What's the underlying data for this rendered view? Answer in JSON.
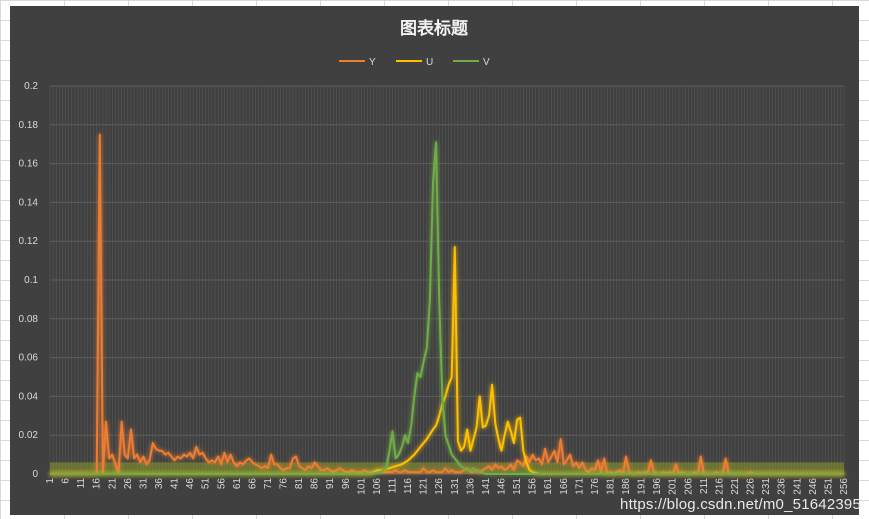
{
  "chart_data": {
    "type": "line",
    "title": "图表标题",
    "xlabel": "",
    "ylabel": "",
    "ylim": [
      0,
      0.2
    ],
    "yticks": [
      "0",
      "0.02",
      "0.04",
      "0.06",
      "0.08",
      "0.1",
      "0.12",
      "0.14",
      "0.16",
      "0.18",
      "0.2"
    ],
    "x_range": [
      1,
      256
    ],
    "x_tick_labels": [
      "1",
      "6",
      "11",
      "16",
      "21",
      "26",
      "31",
      "36",
      "41",
      "46",
      "51",
      "56",
      "61",
      "66",
      "71",
      "76",
      "81",
      "86",
      "91",
      "96",
      "101",
      "106",
      "111",
      "116",
      "121",
      "126",
      "131",
      "136",
      "141",
      "146",
      "151",
      "156",
      "161",
      "166",
      "171",
      "176",
      "181",
      "186",
      "191",
      "196",
      "201",
      "206",
      "211",
      "216",
      "221",
      "226",
      "231",
      "236",
      "241",
      "246",
      "251",
      "256"
    ],
    "legend_position": "top",
    "grid": true,
    "series": [
      {
        "name": "Y",
        "color": "#ed7d31",
        "points": [
          [
            1,
            0
          ],
          [
            16,
            0
          ],
          [
            17,
            0.175
          ],
          [
            18,
            0
          ],
          [
            19,
            0.027
          ],
          [
            20,
            0.008
          ],
          [
            21,
            0.01
          ],
          [
            22,
            0.005
          ],
          [
            23,
            0
          ],
          [
            24,
            0.027
          ],
          [
            25,
            0.01
          ],
          [
            26,
            0.008
          ],
          [
            27,
            0.023
          ],
          [
            28,
            0.008
          ],
          [
            29,
            0.01
          ],
          [
            30,
            0.006
          ],
          [
            31,
            0.009
          ],
          [
            32,
            0.005
          ],
          [
            33,
            0.007
          ],
          [
            34,
            0.016
          ],
          [
            35,
            0.013
          ],
          [
            36,
            0.012
          ],
          [
            37,
            0.012
          ],
          [
            38,
            0.01
          ],
          [
            39,
            0.011
          ],
          [
            40,
            0.009
          ],
          [
            41,
            0.007
          ],
          [
            42,
            0.009
          ],
          [
            43,
            0.008
          ],
          [
            44,
            0.01
          ],
          [
            45,
            0.009
          ],
          [
            46,
            0.011
          ],
          [
            47,
            0.008
          ],
          [
            48,
            0.014
          ],
          [
            49,
            0.01
          ],
          [
            50,
            0.011
          ],
          [
            51,
            0.008
          ],
          [
            52,
            0.006
          ],
          [
            53,
            0.007
          ],
          [
            54,
            0.006
          ],
          [
            55,
            0.009
          ],
          [
            56,
            0.005
          ],
          [
            57,
            0.011
          ],
          [
            58,
            0.006
          ],
          [
            59,
            0.01
          ],
          [
            60,
            0.006
          ],
          [
            61,
            0.004
          ],
          [
            62,
            0.006
          ],
          [
            63,
            0.005
          ],
          [
            64,
            0.007
          ],
          [
            65,
            0.008
          ],
          [
            66,
            0.006
          ],
          [
            67,
            0.005
          ],
          [
            68,
            0.004
          ],
          [
            69,
            0.003
          ],
          [
            70,
            0.004
          ],
          [
            71,
            0.003
          ],
          [
            72,
            0.01
          ],
          [
            73,
            0.005
          ],
          [
            74,
            0.005
          ],
          [
            75,
            0.003
          ],
          [
            76,
            0.002
          ],
          [
            77,
            0.003
          ],
          [
            78,
            0.003
          ],
          [
            79,
            0.008
          ],
          [
            80,
            0.009
          ],
          [
            81,
            0.004
          ],
          [
            82,
            0.003
          ],
          [
            83,
            0.002
          ],
          [
            84,
            0.004
          ],
          [
            85,
            0.003
          ],
          [
            86,
            0.006
          ],
          [
            87,
            0.004
          ],
          [
            88,
            0.002
          ],
          [
            89,
            0.002
          ],
          [
            90,
            0.003
          ],
          [
            91,
            0.002
          ],
          [
            92,
            0.001
          ],
          [
            93,
            0.002
          ],
          [
            94,
            0.003
          ],
          [
            95,
            0.002
          ],
          [
            96,
            0.001
          ],
          [
            97,
            0.001
          ],
          [
            98,
            0.002
          ],
          [
            99,
            0.001
          ],
          [
            100,
            0.001
          ],
          [
            101,
            0.001
          ],
          [
            102,
            0.002
          ],
          [
            103,
            0.001
          ],
          [
            104,
            0.001
          ],
          [
            105,
            0.001
          ],
          [
            106,
            0.001
          ],
          [
            107,
            0.002
          ],
          [
            108,
            0.001
          ],
          [
            109,
            0.001
          ],
          [
            110,
            0.001
          ],
          [
            111,
            0.001
          ],
          [
            112,
            0.002
          ],
          [
            113,
            0.001
          ],
          [
            114,
            0.001
          ],
          [
            115,
            0.002
          ],
          [
            116,
            0.001
          ],
          [
            117,
            0.001
          ],
          [
            118,
            0.001
          ],
          [
            119,
            0.001
          ],
          [
            120,
            0.001
          ],
          [
            121,
            0.003
          ],
          [
            122,
            0.001
          ],
          [
            123,
            0.001
          ],
          [
            124,
            0.002
          ],
          [
            125,
            0.001
          ],
          [
            126,
            0.001
          ],
          [
            127,
            0.001
          ],
          [
            128,
            0.003
          ],
          [
            129,
            0.001
          ],
          [
            130,
            0.002
          ],
          [
            131,
            0.001
          ],
          [
            132,
            0.001
          ],
          [
            133,
            0.001
          ],
          [
            134,
            0.002
          ],
          [
            135,
            0.003
          ],
          [
            136,
            0.001
          ],
          [
            137,
            0.001
          ],
          [
            138,
            0.002
          ],
          [
            139,
            0.001
          ],
          [
            140,
            0.002
          ],
          [
            141,
            0.003
          ],
          [
            142,
            0.004
          ],
          [
            143,
            0.002
          ],
          [
            144,
            0.005
          ],
          [
            145,
            0.003
          ],
          [
            146,
            0.004
          ],
          [
            147,
            0.002
          ],
          [
            148,
            0.003
          ],
          [
            149,
            0.005
          ],
          [
            150,
            0.002
          ],
          [
            151,
            0.007
          ],
          [
            152,
            0.006
          ],
          [
            153,
            0.004
          ],
          [
            154,
            0.009
          ],
          [
            155,
            0.006
          ],
          [
            156,
            0.01
          ],
          [
            157,
            0.007
          ],
          [
            158,
            0.008
          ],
          [
            159,
            0.005
          ],
          [
            160,
            0.013
          ],
          [
            161,
            0.006
          ],
          [
            162,
            0.009
          ],
          [
            163,
            0.012
          ],
          [
            164,
            0.006
          ],
          [
            165,
            0.018
          ],
          [
            166,
            0.005
          ],
          [
            167,
            0.007
          ],
          [
            168,
            0.01
          ],
          [
            169,
            0.004
          ],
          [
            170,
            0.006
          ],
          [
            171,
            0.003
          ],
          [
            172,
            0.006
          ],
          [
            173,
            0.002
          ],
          [
            174,
            0.001
          ],
          [
            175,
            0.003
          ],
          [
            176,
            0.002
          ],
          [
            177,
            0.007
          ],
          [
            178,
            0.001
          ],
          [
            179,
            0.008
          ],
          [
            180,
            0
          ],
          [
            181,
            0.001
          ],
          [
            182,
            0
          ],
          [
            183,
            0.001
          ],
          [
            184,
            0.002
          ],
          [
            185,
            0
          ],
          [
            186,
            0.009
          ],
          [
            187,
            0.001
          ],
          [
            188,
            0
          ],
          [
            189,
            0
          ],
          [
            190,
            0.001
          ],
          [
            191,
            0
          ],
          [
            192,
            0.001
          ],
          [
            193,
            0.001
          ],
          [
            194,
            0.007
          ],
          [
            195,
            0.001
          ],
          [
            196,
            0
          ],
          [
            197,
            0
          ],
          [
            198,
            0.001
          ],
          [
            199,
            0
          ],
          [
            200,
            0.001
          ],
          [
            201,
            0
          ],
          [
            202,
            0.005
          ],
          [
            203,
            0
          ],
          [
            204,
            0.001
          ],
          [
            205,
            0
          ],
          [
            206,
            0
          ],
          [
            207,
            0
          ],
          [
            208,
            0.001
          ],
          [
            209,
            0
          ],
          [
            210,
            0.009
          ],
          [
            211,
            0
          ],
          [
            212,
            0
          ],
          [
            213,
            0
          ],
          [
            214,
            0
          ],
          [
            215,
            0.001
          ],
          [
            216,
            0
          ],
          [
            217,
            0
          ],
          [
            218,
            0.008
          ],
          [
            219,
            0
          ],
          [
            220,
            0
          ],
          [
            221,
            0
          ],
          [
            222,
            0
          ],
          [
            223,
            0
          ],
          [
            224,
            0
          ],
          [
            225,
            0
          ],
          [
            226,
            0.001
          ],
          [
            227,
            0
          ],
          [
            256,
            0
          ]
        ]
      },
      {
        "name": "U",
        "color": "#ffc000",
        "points": [
          [
            1,
            0
          ],
          [
            104,
            0
          ],
          [
            106,
            0.002
          ],
          [
            108,
            0.002
          ],
          [
            110,
            0.003
          ],
          [
            112,
            0.004
          ],
          [
            114,
            0.005
          ],
          [
            116,
            0.007
          ],
          [
            118,
            0.01
          ],
          [
            120,
            0.014
          ],
          [
            122,
            0.018
          ],
          [
            124,
            0.023
          ],
          [
            125,
            0.025
          ],
          [
            126,
            0.03
          ],
          [
            127,
            0.036
          ],
          [
            128,
            0.04
          ],
          [
            129,
            0.046
          ],
          [
            130,
            0.05
          ],
          [
            131,
            0.117
          ],
          [
            132,
            0.017
          ],
          [
            133,
            0.012
          ],
          [
            134,
            0.014
          ],
          [
            135,
            0.023
          ],
          [
            136,
            0.012
          ],
          [
            137,
            0.018
          ],
          [
            138,
            0.024
          ],
          [
            139,
            0.04
          ],
          [
            140,
            0.024
          ],
          [
            141,
            0.025
          ],
          [
            142,
            0.03
          ],
          [
            143,
            0.046
          ],
          [
            144,
            0.026
          ],
          [
            145,
            0.018
          ],
          [
            146,
            0.012
          ],
          [
            147,
            0.02
          ],
          [
            148,
            0.027
          ],
          [
            149,
            0.022
          ],
          [
            150,
            0.016
          ],
          [
            151,
            0.028
          ],
          [
            152,
            0.029
          ],
          [
            153,
            0.012
          ],
          [
            154,
            0.006
          ],
          [
            155,
            0.002
          ],
          [
            156,
            0.001
          ],
          [
            158,
            0
          ],
          [
            256,
            0
          ]
        ]
      },
      {
        "name": "V",
        "color": "#70ad47",
        "points": [
          [
            1,
            0
          ],
          [
            104,
            0
          ],
          [
            107,
            0.001
          ],
          [
            109,
            0.003
          ],
          [
            110,
            0.012
          ],
          [
            111,
            0.022
          ],
          [
            112,
            0.008
          ],
          [
            113,
            0.01
          ],
          [
            114,
            0.014
          ],
          [
            115,
            0.02
          ],
          [
            116,
            0.016
          ],
          [
            117,
            0.025
          ],
          [
            118,
            0.04
          ],
          [
            119,
            0.052
          ],
          [
            120,
            0.05
          ],
          [
            121,
            0.058
          ],
          [
            122,
            0.065
          ],
          [
            123,
            0.09
          ],
          [
            124,
            0.15
          ],
          [
            125,
            0.171
          ],
          [
            126,
            0.09
          ],
          [
            127,
            0.04
          ],
          [
            128,
            0.02
          ],
          [
            129,
            0.015
          ],
          [
            130,
            0.01
          ],
          [
            131,
            0.008
          ],
          [
            132,
            0.006
          ],
          [
            133,
            0.004
          ],
          [
            134,
            0.003
          ],
          [
            135,
            0.002
          ],
          [
            136,
            0.002
          ],
          [
            137,
            0.003
          ],
          [
            138,
            0.001
          ],
          [
            139,
            0.001
          ],
          [
            141,
            0
          ],
          [
            256,
            0
          ]
        ]
      }
    ]
  },
  "watermark": "https://blog.csdn.net/m0_51642395"
}
